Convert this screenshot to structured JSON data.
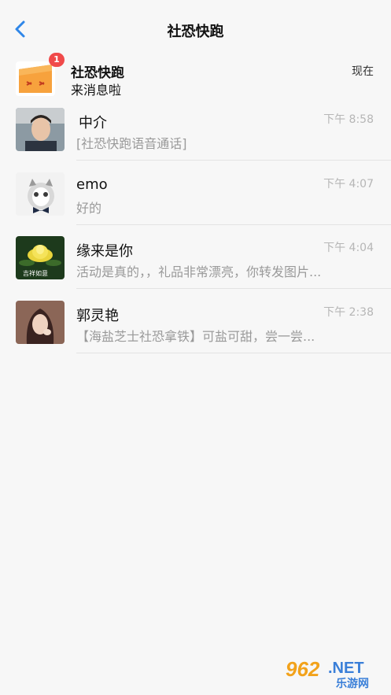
{
  "header": {
    "title": "社恐快跑",
    "back_icon": "chevron-left-icon"
  },
  "colors": {
    "accent": "#2f86e8",
    "badge": "#f04a4a",
    "background": "#f7f7f7"
  },
  "system_message": {
    "name": "社恐快跑",
    "preview": "来消息啦",
    "time": "现在",
    "badge": "1"
  },
  "chats": [
    {
      "name": "中介",
      "preview": "[社恐快跑语音通话]",
      "time": "下午 8:58"
    },
    {
      "name": "emo",
      "preview": "好的",
      "time": "下午 4:07"
    },
    {
      "name": "缘来是你",
      "preview": "活动是真的，，礼品非常漂亮，你转发图片...",
      "time": "下午 4:04",
      "avatar_caption": "吉祥如意"
    },
    {
      "name": "郭灵艳",
      "preview": "【海盐芝士社恐拿铁】可盐可甜，尝一尝...",
      "time": "下午 2:38"
    }
  ],
  "watermark": {
    "number": "962",
    "net": ".NET",
    "text": "乐游网"
  }
}
